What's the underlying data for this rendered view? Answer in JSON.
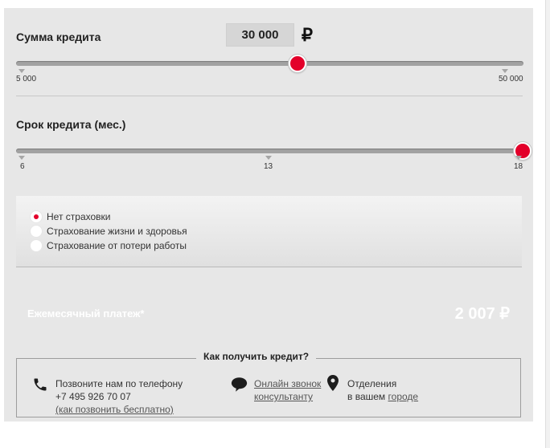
{
  "loan_amount": {
    "label": "Сумма кредита",
    "value": "30 000",
    "currency_symbol": "₽",
    "min_label": "5 000",
    "max_label": "50 000",
    "slider_position": 0.6
  },
  "loan_term": {
    "label": "Срок кредита (мес.)",
    "ticks": [
      "6",
      "13",
      "18"
    ],
    "slider_position": 1.0
  },
  "insurance": {
    "options": [
      {
        "label": "Нет страховки",
        "selected": true
      },
      {
        "label": "Страхование жизни и здоровья",
        "selected": false
      },
      {
        "label": "Страхование от потери работы",
        "selected": false
      }
    ]
  },
  "monthly_payment": {
    "label": "Ежемесячный платеж*",
    "value": "2 007 ₽"
  },
  "how_to_get": {
    "title": "Как получить кредит?",
    "phone": {
      "line1": "Позвоните нам по телефону",
      "number": "+7 495 926 70 07",
      "free_link": "(как позвонить бесплатно)",
      "icon": "phone-icon"
    },
    "online": {
      "line1": "Онлайн звонок",
      "line2": "консультанту",
      "icon": "chat-bubble-icon"
    },
    "branches": {
      "line1": "Отделения",
      "line2_prefix": "в вашем",
      "city_link": "городе",
      "icon": "location-pin-icon"
    }
  },
  "colors": {
    "accent": "#e3002a",
    "panel": "#e7e7e7",
    "track": "#a2a2a2"
  }
}
